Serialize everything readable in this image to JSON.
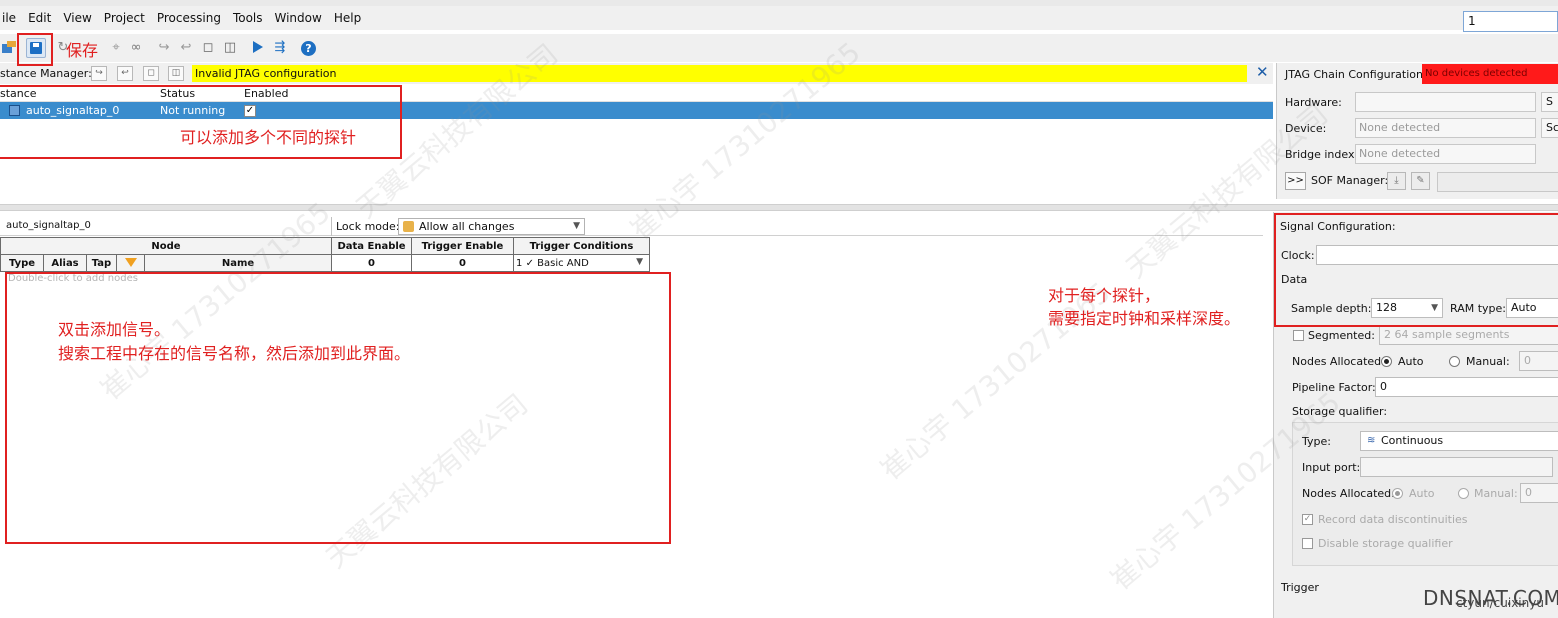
{
  "menubar": {
    "items": [
      {
        "pre": "",
        "u": "F",
        "post": "ile",
        "shown": "ile",
        "underline": ""
      },
      {
        "label": "Edit"
      },
      {
        "label": "View"
      },
      {
        "label": "Project"
      },
      {
        "label": "Processing"
      },
      {
        "label": "Tools"
      },
      {
        "label": "Window"
      },
      {
        "label": "Help"
      }
    ],
    "labels": [
      "ile",
      "Edit",
      "View",
      "Project",
      "Processing",
      "Tools",
      "Window",
      "Help"
    ],
    "quick_search_value": "1"
  },
  "toolbar": {
    "save_tooltip_annotation": "保存",
    "icons": [
      "new-file-icon",
      "save-icon",
      "refresh-icon",
      "autorun-icon",
      "binoculars-icon",
      "stop-icon",
      "split-icon",
      "run-icon",
      "autorun-analysis-icon",
      "help-icon"
    ],
    "help_label": "?"
  },
  "instance_manager": {
    "label": "stance Manager:",
    "message": "Invalid JTAG configuration",
    "columns": [
      "stance",
      "Status",
      "Enabled"
    ],
    "rows": [
      {
        "instance": "auto_signaltap_0",
        "status": "Not running",
        "enabled": "✓"
      }
    ],
    "annotation": "可以添加多个不同的探针"
  },
  "jtag": {
    "title": "JTAG Chain Configuration:",
    "status": "No devices detected",
    "hardware_label": "Hardware:",
    "hardware_value": "",
    "hardware_btn": "S",
    "device_label": "Device:",
    "device_value": "None detected",
    "device_btn": "Sc",
    "bridge_label": "Bridge index:",
    "bridge_value": "None detected",
    "sof_btn": ">>",
    "sof_label": "SOF Manager:"
  },
  "node_panel": {
    "tab": "auto_signaltap_0",
    "lock_label": "Lock mode:",
    "lock_value": "Allow all changes",
    "header_node": "Node",
    "header_data_enable": "Data Enable",
    "header_trigger_enable": "Trigger Enable",
    "header_trigger_conditions": "Trigger Conditions",
    "col_type": "Type",
    "col_alias": "Alias",
    "col_tap": "Tap",
    "col_name": "Name",
    "data_enable_count": "0",
    "trigger_enable_count": "0",
    "trigger_cond_index": "1",
    "trigger_cond_check": "✓",
    "trigger_cond_value": "Basic AND",
    "empty_hint": "Double-click to add nodes",
    "annotation_line1": "双击添加信号。",
    "annotation_line2": "搜索工程中存在的信号名称，然后添加到此界面。"
  },
  "signal_config": {
    "title": "Signal Configuration:",
    "clock_label": "Clock:",
    "clock_value": "",
    "data_label": "Data",
    "sample_depth_label": "Sample depth:",
    "sample_depth_value": "128",
    "ram_type_label": "RAM type:",
    "ram_type_value": "Auto",
    "segmented_label": "Segmented:",
    "segmented_value": "2  64 sample segments",
    "nodes_alloc_label": "Nodes Allocated:",
    "auto_label": "Auto",
    "manual_label": "Manual:",
    "manual_value": "0",
    "pipeline_label": "Pipeline Factor:",
    "pipeline_value": "0",
    "storage_label": "Storage qualifier:",
    "type_label": "Type:",
    "type_value": "Continuous",
    "input_port_label": "Input port:",
    "input_port_value": "",
    "nodes_alloc2_label": "Nodes Allocated:",
    "auto2_label": "Auto",
    "manual2_label": "Manual:",
    "manual2_value": "0",
    "record_label": "Record data discontinuities",
    "disable_label": "Disable storage qualifier",
    "trigger_label": "Trigger",
    "annotation_line1": "对于每个探针，",
    "annotation_line2": "需要指定时钟和采样深度。"
  },
  "watermark": {
    "texts": [
      "天翼云科技有限公司",
      "崔心宇 17310271965"
    ]
  },
  "credits": {
    "brand": "DNSNAT.COM",
    "author": "ctyun/cuixinyu"
  },
  "colors": {
    "annotation": "#e02020",
    "warning_bg": "#ffff00",
    "error_bg": "#ff1a1a",
    "selection": "#3a8ccd"
  }
}
